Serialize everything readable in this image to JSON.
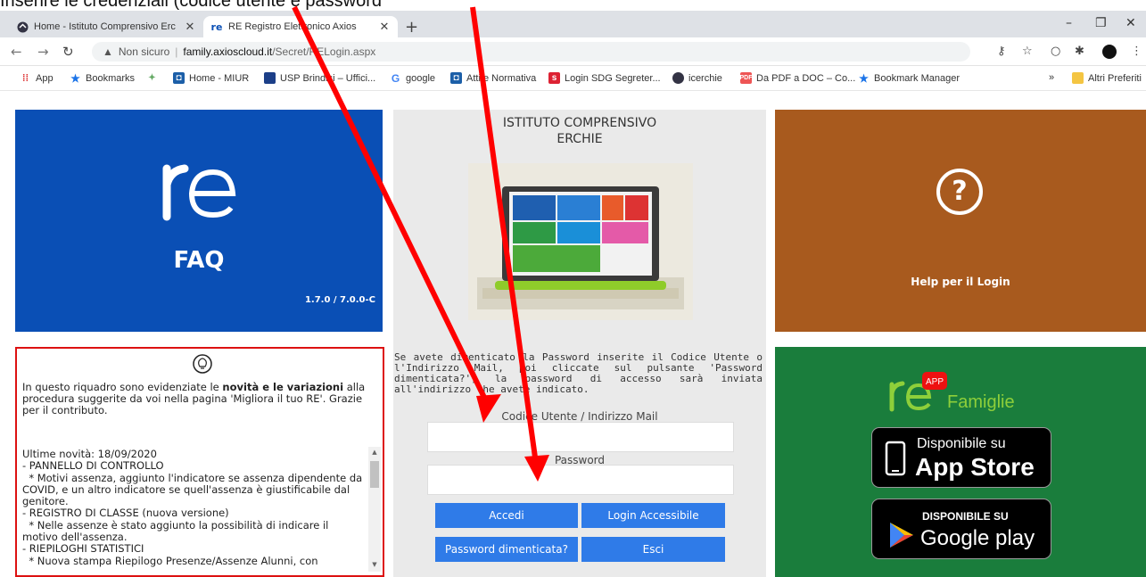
{
  "caption": "Inserire le credenziali (codice utente e password",
  "browser": {
    "tabs": [
      {
        "title": "Home - Istituto Comprensivo Erc"
      },
      {
        "title": "RE Registro Elettronico Axios"
      }
    ],
    "new_tab": "+",
    "window": {
      "minimize": "–",
      "restore": "❐",
      "close": "✕"
    },
    "url": {
      "security": "Non sicuro",
      "separator": "|",
      "domain": "family.axioscloud.it",
      "path": "/Secret/RELogin.aspx"
    },
    "bookmarks": [
      "App",
      "Bookmarks",
      "Home - MIUR",
      "USP Brindisi – Uffici...",
      "google",
      "Atti e Normativa",
      "Login SDG Segreter...",
      "icerchie",
      "Da PDF a DOC – Co...",
      "Bookmark Manager",
      "Altri Preferiti"
    ],
    "overflow": "»"
  },
  "faq": {
    "label": "FAQ",
    "version": "1.7.0 / 7.0.0-C"
  },
  "help": {
    "label": "Help per il Login",
    "symbol": "?"
  },
  "login": {
    "school": "ISTITUTO COMPRENSIVO\nERCHIE",
    "info": "Se avete dimenticato la Password inserite il Codice Utente o l'Indirizzo Mail, poi cliccate sul pulsante 'Password dimenticata?', la password di accesso sarà inviata all'indirizzo che avete indicato.",
    "user_label": "Codice Utente / Indirizzo Mail",
    "user_value": "",
    "password_label": "Password",
    "password_value": "",
    "buttons": {
      "login": "Accedi",
      "accessible": "Login Accessibile",
      "forgot": "Password dimenticata?",
      "exit": "Esci"
    }
  },
  "news": {
    "intro_1": "In questo riquadro sono evidenziate le ",
    "intro_bold": "novità e le variazioni",
    "intro_2": " alla procedura suggerite da voi nella pagina 'Migliora il tuo RE'. Grazie per il contributo.",
    "lines": [
      "Ultime novità: 18/09/2020",
      "- PANNELLO DI CONTROLLO",
      "  * Motivi assenza, aggiunto l'indicatore se assenza dipendente da COVID, e un altro indicatore se quell'assenza è giustificabile dal genitore.",
      "- REGISTRO DI CLASSE (nuova versione)",
      "  * Nelle assenze è stato aggiunto la possibilità di indicare il motivo dell'assenza.",
      "- RIEPILOGHI STATISTICI",
      "  * Nuova stampa Riepilogo Presenze/Assenze Alunni, con"
    ]
  },
  "app": {
    "brand": "Famiglie",
    "badge": "APP",
    "appstore_small": "Disponibile su",
    "appstore_big": "App Store",
    "play_small": "DISPONIBILE SU",
    "play_big": "Google play"
  },
  "colors": {
    "faq_blue": "#0a4fb5",
    "help_orange": "#a85a1e",
    "app_green": "#1a7d3c",
    "button_blue": "#2f7be8",
    "arrow_red": "#ff0000",
    "news_border": "#dd1111"
  }
}
